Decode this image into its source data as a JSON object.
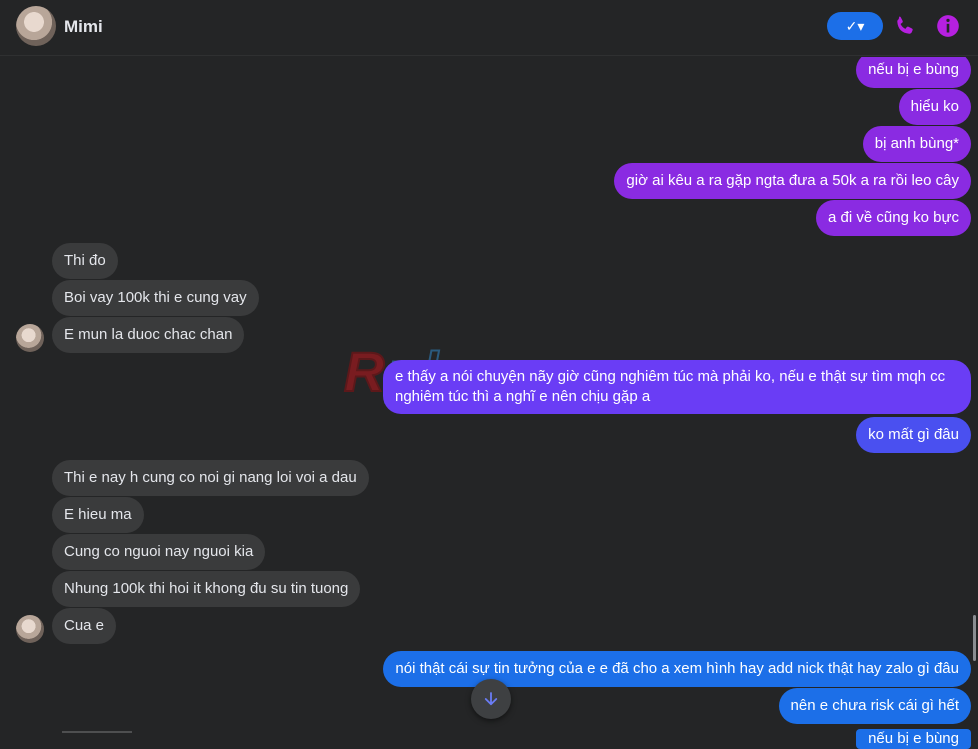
{
  "header": {
    "contact_name": "Mimi",
    "status_button_label": "✓▾",
    "icons": [
      "phone-icon",
      "info-icon"
    ]
  },
  "messages": [
    {
      "side": "out",
      "text": "nếu bị e bùng"
    },
    {
      "side": "out",
      "text": "hiểu ko"
    },
    {
      "side": "out",
      "text": "bị anh bùng*"
    },
    {
      "side": "out",
      "text": "giờ ai kêu a ra gặp ngta đưa a 50k a ra rồi leo cây"
    },
    {
      "side": "out",
      "text": "a đi về cũng ko bực"
    },
    {
      "side": "in",
      "text": "Thi đo"
    },
    {
      "side": "in",
      "text": "Boi vay 100k thi e cung vay"
    },
    {
      "side": "in",
      "text": "E mun la duoc chac chan"
    },
    {
      "side": "out",
      "text": "e thấy a nói chuyện nãy giờ cũng nghiêm túc mà phải ko, nếu e thật sự tìm mqh cc nghiêm túc thì a nghĩ e nên chịu gặp a"
    },
    {
      "side": "out",
      "text": "ko mất gì đâu"
    },
    {
      "side": "in",
      "text": "Thi e nay h cung co noi gi nang loi voi a dau"
    },
    {
      "side": "in",
      "text": "E hieu ma"
    },
    {
      "side": "in",
      "text": "Cung co nguoi nay nguoi kia"
    },
    {
      "side": "in",
      "text": "Nhung 100k thi hoi it khong đu su tin tuong"
    },
    {
      "side": "in",
      "text": "Cua e"
    },
    {
      "side": "out",
      "text": "nói thật cái sự tin tưởng của e e đã cho a xem hình hay add nick thật hay zalo gì đâu"
    },
    {
      "side": "out",
      "text": "nên e chưa risk cái gì hết"
    },
    {
      "side": "out",
      "text": "nếu bị e bùng"
    }
  ],
  "watermark": {
    "text_red": "R",
    "text_blue": "phang"
  },
  "colors": {
    "background": "#242526",
    "incoming_bubble": "#3a3b3c",
    "outgoing_purple": "#8a2be2",
    "outgoing_blue": "#1c6fe8",
    "accent_icon": "#b620e0"
  }
}
